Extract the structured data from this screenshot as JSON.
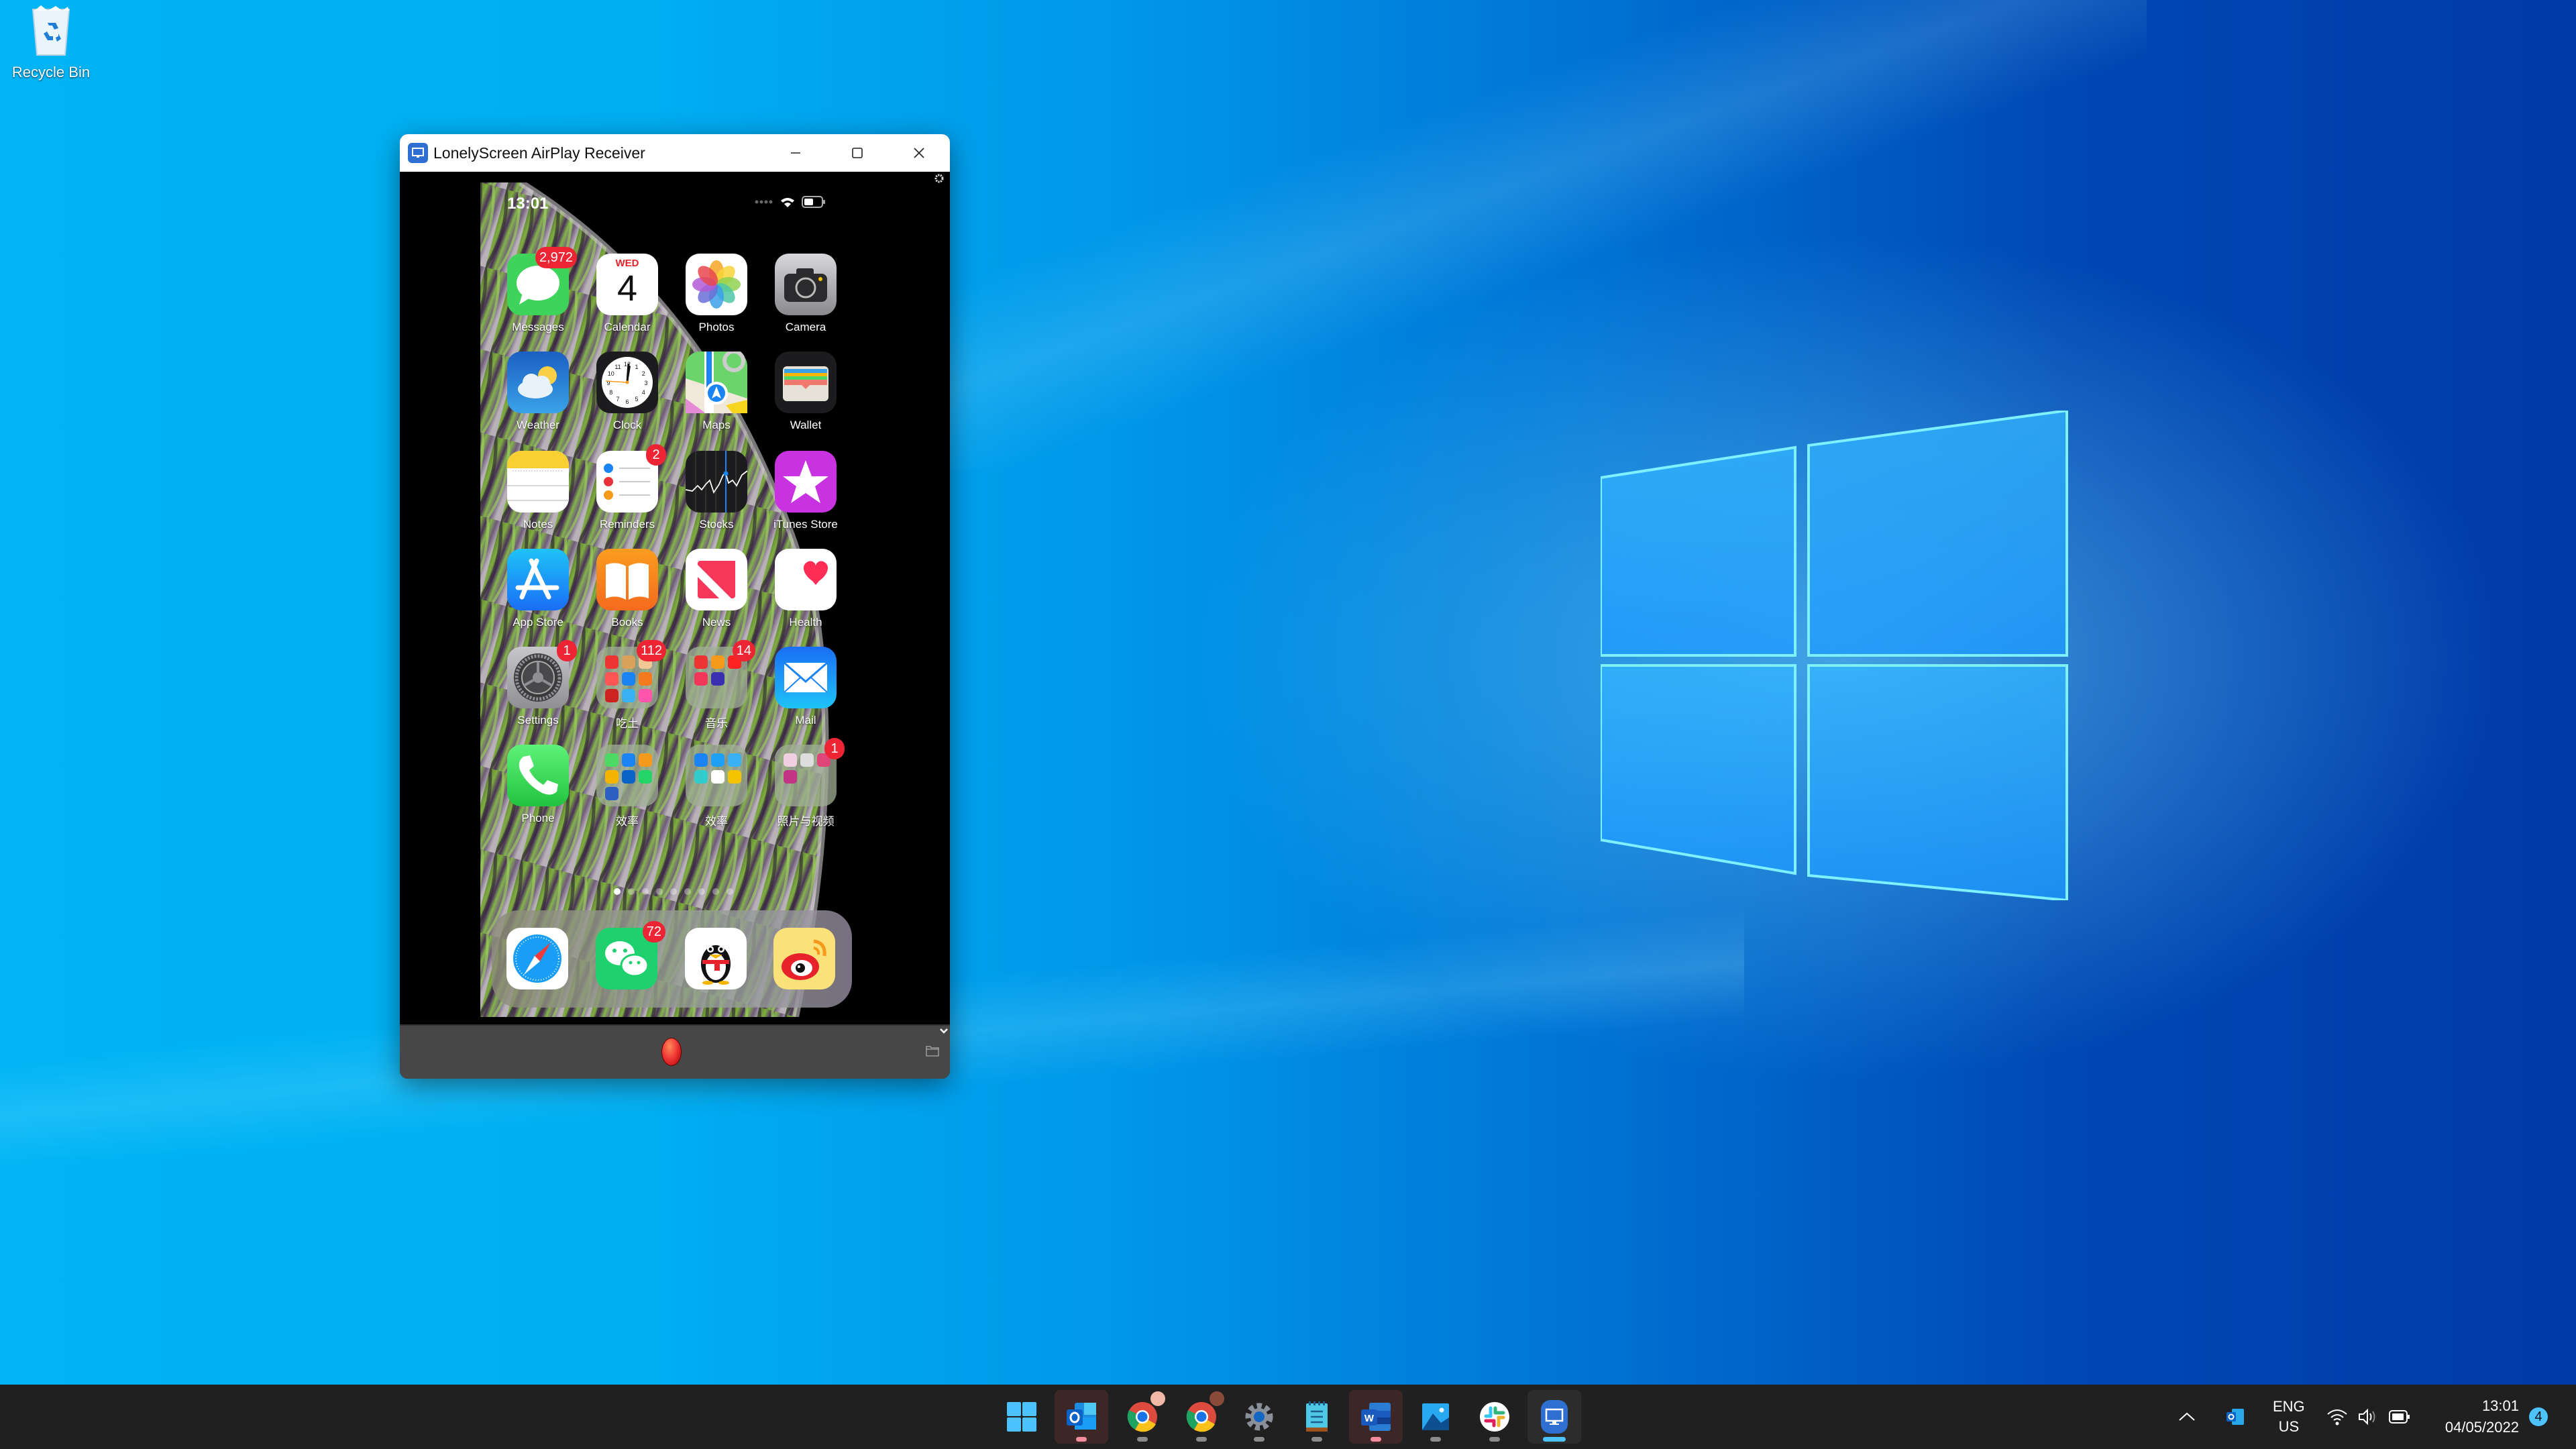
{
  "desktop": {
    "icons": [
      {
        "label": "Recycle Bin",
        "icon": "recycle-bin-icon"
      }
    ]
  },
  "window": {
    "title": "LonelyScreen AirPlay Receiver",
    "controls": {
      "minimize": "minimize-icon",
      "maximize": "maximize-icon",
      "close": "close-icon"
    }
  },
  "phone": {
    "status_time": "13:01",
    "calendar_day": "WED",
    "calendar_date": "4",
    "apps": [
      {
        "name": "Messages",
        "badge": "2,972",
        "icon": "messages-icon",
        "color": "#34c759"
      },
      {
        "name": "Calendar",
        "badge": "",
        "icon": "calendar-icon",
        "color": "#ffffff"
      },
      {
        "name": "Photos",
        "badge": "",
        "icon": "photos-icon",
        "color": "#ffffff"
      },
      {
        "name": "Camera",
        "badge": "",
        "icon": "camera-icon",
        "color": "#9a9a9e"
      },
      {
        "name": "Weather",
        "badge": "",
        "icon": "weather-icon",
        "color": "#2a7de1"
      },
      {
        "name": "Clock",
        "badge": "",
        "icon": "clock-icon",
        "color": "#1c1c1e"
      },
      {
        "name": "Maps",
        "badge": "",
        "icon": "maps-icon",
        "color": "#6bd46b"
      },
      {
        "name": "Wallet",
        "badge": "",
        "icon": "wallet-icon",
        "color": "#1c1c1e"
      },
      {
        "name": "Notes",
        "badge": "",
        "icon": "notes-icon",
        "color": "#ffffff"
      },
      {
        "name": "Reminders",
        "badge": "2",
        "icon": "reminders-icon",
        "color": "#ffffff"
      },
      {
        "name": "Stocks",
        "badge": "",
        "icon": "stocks-icon",
        "color": "#1c1c1e"
      },
      {
        "name": "iTunes Store",
        "badge": "",
        "icon": "itunes-store-icon",
        "color": "#c932e0"
      },
      {
        "name": "App Store",
        "badge": "",
        "icon": "app-store-icon",
        "color": "#1a8cff"
      },
      {
        "name": "Books",
        "badge": "",
        "icon": "books-icon",
        "color": "#f7901e"
      },
      {
        "name": "News",
        "badge": "",
        "icon": "news-icon",
        "color": "#ffffff"
      },
      {
        "name": "Health",
        "badge": "",
        "icon": "health-icon",
        "color": "#ffffff"
      },
      {
        "name": "Settings",
        "badge": "1",
        "icon": "settings-icon",
        "color": "#8e8e93"
      },
      {
        "name": "吃土",
        "badge": "112",
        "icon": "folder-icon",
        "folder": true
      },
      {
        "name": "音乐",
        "badge": "14",
        "icon": "folder-icon",
        "folder": true
      },
      {
        "name": "Mail",
        "badge": "",
        "icon": "mail-icon",
        "color": "#1f8bf5"
      },
      {
        "name": "Phone",
        "badge": "",
        "icon": "phone-icon",
        "color": "#34c759"
      },
      {
        "name": "效率",
        "badge": "",
        "icon": "folder-icon",
        "folder": true
      },
      {
        "name": "效率",
        "badge": "",
        "icon": "folder-icon",
        "folder": true
      },
      {
        "name": "照片与视频",
        "badge": "1",
        "icon": "folder-icon",
        "folder": true
      }
    ],
    "page_count": 9,
    "current_page": 1,
    "dock": [
      {
        "name": "Safari",
        "badge": "",
        "icon": "safari-icon"
      },
      {
        "name": "WeChat",
        "badge": "72",
        "icon": "wechat-icon"
      },
      {
        "name": "QQ",
        "badge": "",
        "icon": "qq-icon"
      },
      {
        "name": "Weibo",
        "badge": "",
        "icon": "weibo-icon"
      }
    ]
  },
  "bottom_bar": {
    "record": "record-button",
    "folder": "folder-icon",
    "collapse": "chevron-down-icon"
  },
  "taskbar": {
    "items": [
      {
        "name": "Start",
        "icon": "windows-start-icon",
        "state": "none"
      },
      {
        "name": "Outlook",
        "icon": "outlook-icon",
        "state": "attention"
      },
      {
        "name": "Chrome",
        "icon": "chrome-icon",
        "state": "running"
      },
      {
        "name": "Chrome",
        "icon": "chrome-icon",
        "state": "running"
      },
      {
        "name": "Settings",
        "icon": "settings-gear-icon",
        "state": "running"
      },
      {
        "name": "Notepad",
        "icon": "notepad-icon",
        "state": "running"
      },
      {
        "name": "Word",
        "icon": "word-icon",
        "state": "attention"
      },
      {
        "name": "Photos",
        "icon": "photos-app-icon",
        "state": "running"
      },
      {
        "name": "Slack",
        "icon": "slack-icon",
        "state": "running"
      },
      {
        "name": "LonelyScreen",
        "icon": "lonelyscreen-icon",
        "state": "active"
      }
    ],
    "tray": {
      "lang_line1": "ENG",
      "lang_line2": "US",
      "time": "13:01",
      "date": "04/05/2022",
      "notifications": "4"
    }
  },
  "colors": {
    "taskbar_bg": "#202020",
    "badge_red": "#ec2434",
    "accent_blue": "#4cc2ff"
  }
}
